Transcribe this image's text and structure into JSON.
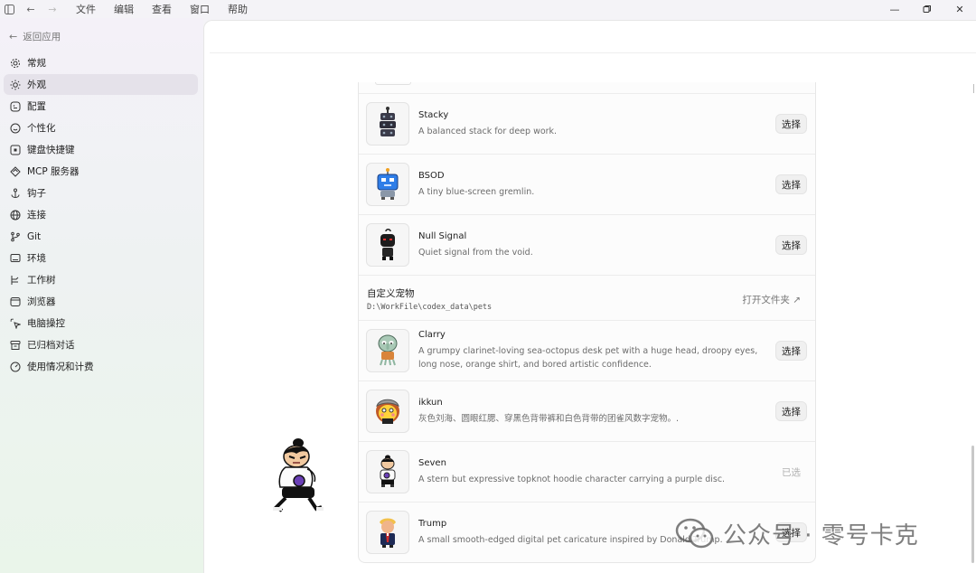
{
  "menu": [
    "文件",
    "编辑",
    "查看",
    "窗口",
    "帮助"
  ],
  "sidebar": {
    "back_label": "返回应用",
    "items": [
      {
        "label": "常规",
        "icon": "gear-icon"
      },
      {
        "label": "外观",
        "icon": "sun-icon",
        "active": true
      },
      {
        "label": "配置",
        "icon": "config-icon"
      },
      {
        "label": "个性化",
        "icon": "smile-icon"
      },
      {
        "label": "键盘快捷键",
        "icon": "keyboard-icon"
      },
      {
        "label": "MCP 服务器",
        "icon": "mcp-icon"
      },
      {
        "label": "钩子",
        "icon": "hook-icon"
      },
      {
        "label": "连接",
        "icon": "globe-icon"
      },
      {
        "label": "Git",
        "icon": "git-branch-icon"
      },
      {
        "label": "环境",
        "icon": "monitor-icon"
      },
      {
        "label": "工作树",
        "icon": "worktree-icon"
      },
      {
        "label": "浏览器",
        "icon": "browser-icon"
      },
      {
        "label": "电脑操控",
        "icon": "pointer-icon"
      },
      {
        "label": "已归档对话",
        "icon": "archive-icon"
      },
      {
        "label": "使用情况和计费",
        "icon": "gauge-icon"
      }
    ]
  },
  "pets_builtin": [
    {
      "name": "Stacky",
      "desc": "A balanced stack for deep work.",
      "button": "选择"
    },
    {
      "name": "BSOD",
      "desc": "A tiny blue-screen gremlin.",
      "button": "选择"
    },
    {
      "name": "Null Signal",
      "desc": "Quiet signal from the void.",
      "button": "选择"
    }
  ],
  "custom_section": {
    "title": "自定义宠物",
    "path": "D:\\WorkFile\\codex_data\\pets",
    "open_folder": "打开文件夹 ↗"
  },
  "pets_custom": [
    {
      "name": "Clarry",
      "desc": "A grumpy clarinet-loving sea-octopus desk pet with a huge head, droopy eyes, long nose, orange shirt, and bored artistic confidence.",
      "button": "选择"
    },
    {
      "name": "ikkun",
      "desc": "灰色刘海、圆眼红腮、穿黑色背带裤和白色背带的团雀风数字宠物。.",
      "button": "选择"
    },
    {
      "name": "Seven",
      "desc": "A stern but expressive topknot hoodie character carrying a purple disc.",
      "button": "已选",
      "selected": true
    },
    {
      "name": "Trump",
      "desc": "A small smooth-edged digital pet caricature inspired by Donald Trump.",
      "button": "选择"
    }
  ],
  "watermark": "公众号 · 零号卡克"
}
